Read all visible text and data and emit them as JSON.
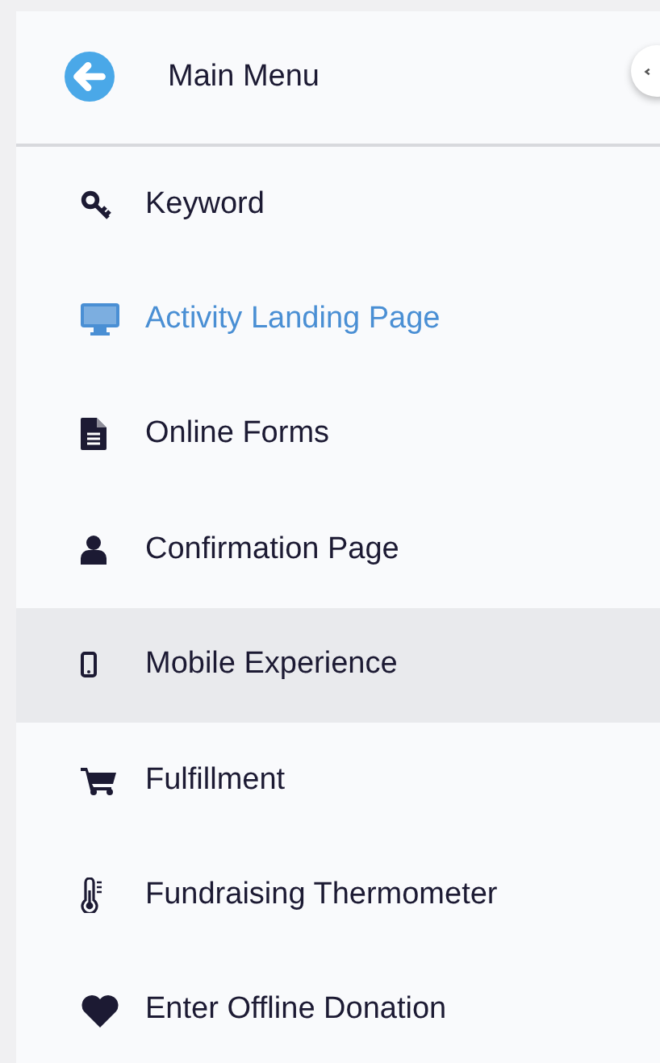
{
  "header": {
    "title": "Main Menu"
  },
  "menu_items": [
    {
      "label": "Keyword",
      "selected": false,
      "hovered": false
    },
    {
      "label": "Activity Landing Page",
      "selected": true,
      "hovered": false
    },
    {
      "label": "Online Forms",
      "selected": false,
      "hovered": false
    },
    {
      "label": "Confirmation Page",
      "selected": false,
      "hovered": false
    },
    {
      "label": "Mobile Experience",
      "selected": false,
      "hovered": true
    },
    {
      "label": "Fulfillment",
      "selected": false,
      "hovered": false
    },
    {
      "label": "Fundraising Thermometer",
      "selected": false,
      "hovered": false
    },
    {
      "label": "Enter Offline Donation",
      "selected": false,
      "hovered": false
    }
  ]
}
